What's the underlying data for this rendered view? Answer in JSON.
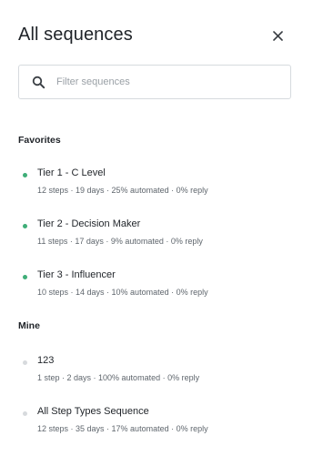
{
  "panel": {
    "title": "All sequences",
    "close_icon": "close-icon"
  },
  "search": {
    "icon": "search-icon",
    "placeholder": "Filter sequences",
    "value": ""
  },
  "colors": {
    "active_dot": "#3fae78",
    "inactive_dot": "#d7dadd"
  },
  "favorites": {
    "heading": "Favorites",
    "items": [
      {
        "name": "Tier 1 - C Level",
        "meta": "12 steps · 19 days · 25% automated · 0% reply",
        "status": "active"
      },
      {
        "name": "Tier 2 - Decision Maker",
        "meta": "11 steps · 17 days · 9% automated · 0% reply",
        "status": "active"
      },
      {
        "name": "Tier 3 - Influencer",
        "meta": "10 steps · 14 days · 10% automated · 0% reply",
        "status": "active"
      }
    ]
  },
  "mine": {
    "heading": "Mine",
    "items": [
      {
        "name": "123",
        "meta": "1 step · 2 days · 100% automated · 0% reply",
        "status": "inactive"
      },
      {
        "name": "All Step Types Sequence",
        "meta": "12 steps · 35 days · 17% automated · 0% reply",
        "status": "inactive"
      }
    ]
  }
}
